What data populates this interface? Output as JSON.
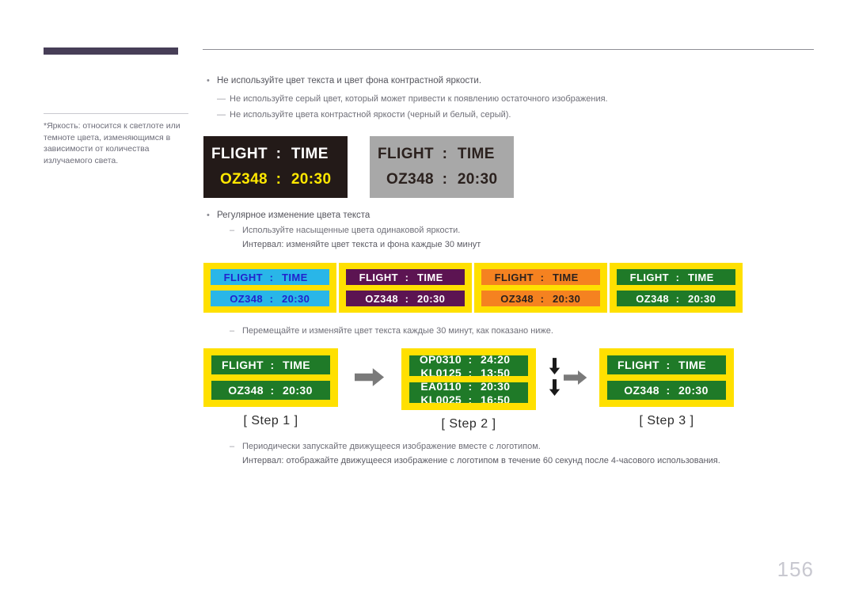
{
  "sidebar": {
    "note": "*Яркость: относится к светлоте или темноте цвета, изменяющимся в зависимости от количества излучаемого света."
  },
  "content": {
    "bullet_1": "Не используйте цвет текста и цвет фона контрастной яркости.",
    "dash_1": "Не используйте серый цвет, который может привести к появлению остаточного изображения.",
    "dash_2": "Не используйте цвета контрастной яркости (черный и белый, серый).",
    "bullet_2": "Регулярное изменение цвета текста",
    "dash_3": "Используйте насыщенные цвета одинаковой яркости.",
    "sub_3": "Интервал: изменяйте цвет текста и фона каждые 30 минут",
    "dash_4": "Перемещайте и изменяйте цвет текста каждые 30 минут, как показано ниже.",
    "dash_5": "Периодически запускайте движущееся изображение вместе с логотипом.",
    "sub_5": "Интервал: отображайте движущееся изображение с логотипом в течение 60 секунд после 4-часового использования.",
    "dash_mark": "–",
    "long_dash_mark": "—",
    "bullet_mark": "•"
  },
  "labels": {
    "flight": "FLIGHT",
    "time": "TIME",
    "code": "OZ348",
    "clock": "20:30",
    "separator": ":"
  },
  "panels": {
    "dark": {
      "name": "dark-contrast-panel",
      "bg": "#231a18",
      "header_color": "#ffffff",
      "value_color": "#ffe800"
    },
    "gray": {
      "name": "gray-contrast-panel",
      "bg": "#a8a8a8",
      "header_color": "#2b211e",
      "value_color": "#2b211e"
    },
    "color_set": [
      {
        "name": "cyan-on-yellow",
        "frame": "#ffe000",
        "inner": "#29b6e8",
        "text": "#2222cc"
      },
      {
        "name": "white-on-purple",
        "frame": "#ffe000",
        "inner": "#5c1452",
        "text": "#ffffff"
      },
      {
        "name": "dark-on-orange",
        "frame": "#ffe000",
        "inner": "#f58220",
        "text": "#2b211e"
      },
      {
        "name": "white-on-green",
        "frame": "#ffe000",
        "inner": "#1f7a28",
        "text": "#ffffff"
      }
    ]
  },
  "steps": [
    {
      "label": "[ Step 1 ]",
      "frame": "#ffe000",
      "inner": "#1f7a28",
      "text": "#ffffff",
      "rows": [
        {
          "a": "FLIGHT",
          "sep": ":",
          "b": "TIME"
        },
        {
          "a": "OZ348",
          "sep": ":",
          "b": "20:30"
        }
      ]
    },
    {
      "label": "[ Step 2 ]",
      "frame": "#ffe000",
      "inner": "#1f7a28",
      "text": "#ffffff",
      "scrolling": true,
      "groups": [
        [
          {
            "a": "OP0310",
            "sep": ":",
            "b": "24:20"
          },
          {
            "a": "KL0125",
            "sep": ":",
            "b": "13:50"
          }
        ],
        [
          {
            "a": "EA0110",
            "sep": ":",
            "b": "20:30"
          },
          {
            "a": "KL0025",
            "sep": ":",
            "b": "16:50"
          }
        ]
      ]
    },
    {
      "label": "[ Step 3 ]",
      "frame": "#ffe000",
      "inner": "#1f7a28",
      "text": "#ffffff",
      "rows": [
        {
          "a": "FLIGHT",
          "sep": ":",
          "b": "TIME"
        },
        {
          "a": "OZ348",
          "sep": ":",
          "b": "20:30"
        }
      ]
    }
  ],
  "icons": {
    "arrow_right": "arrow-right-icon",
    "arrow_down": "arrow-down-icon"
  },
  "footer": {
    "page_number": "156"
  },
  "theme": {
    "sidebar_bar": "#473e57",
    "rule": "#8e8e96",
    "page_number_color": "#c8c8d0",
    "gray_arrow": "#7a7a7a",
    "black_arrow": "#1a1a1a"
  }
}
